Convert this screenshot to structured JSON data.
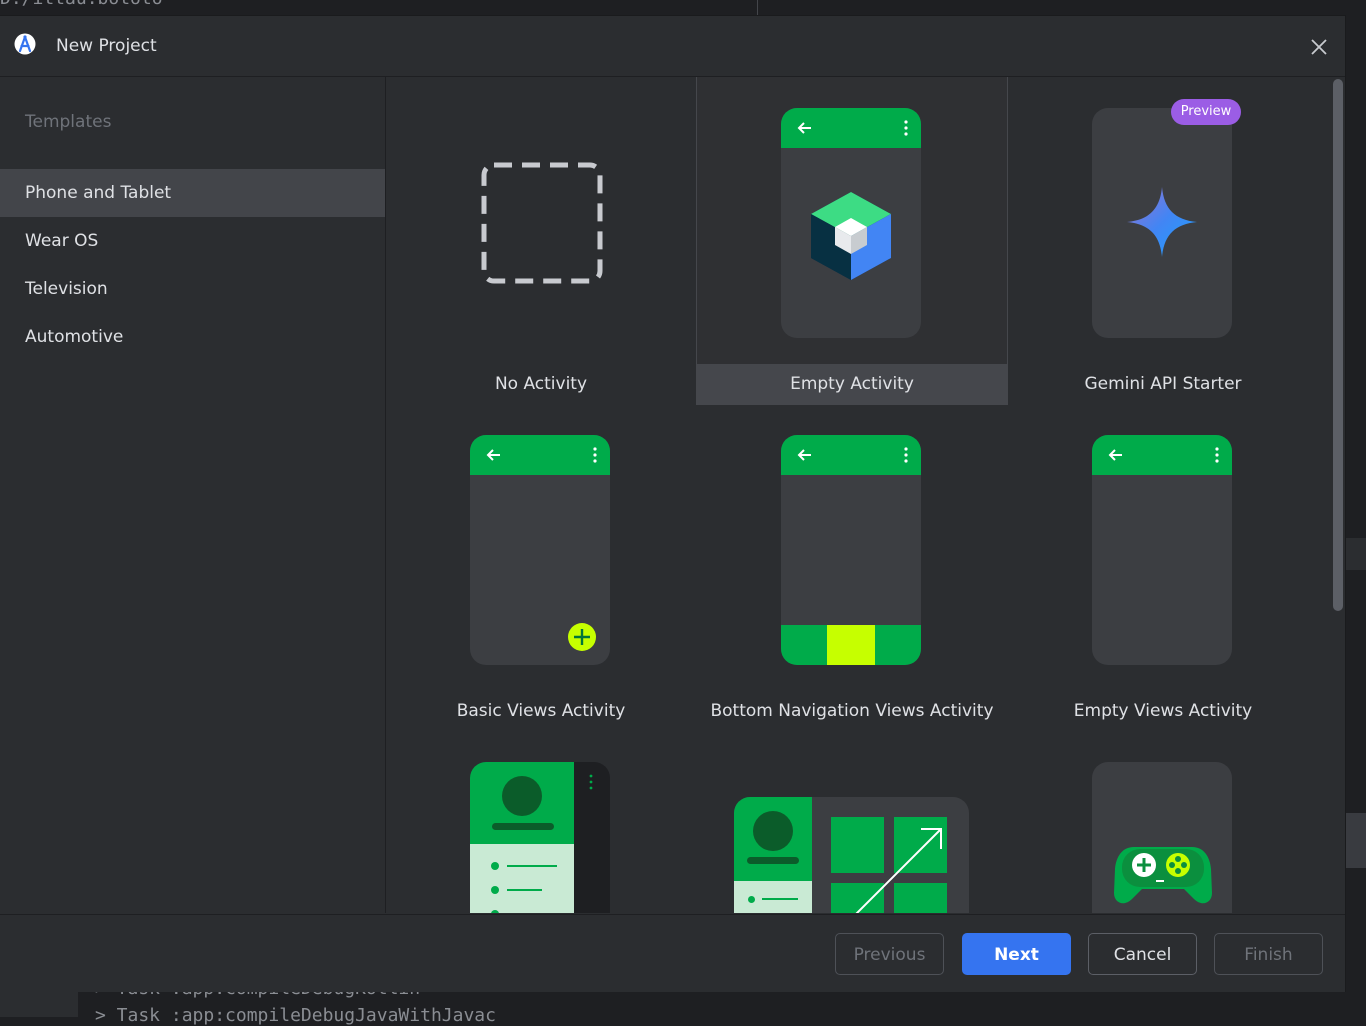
{
  "background": {
    "code_top": "D:/ittau:bototo",
    "code_line1": "> Task :app:compileDebugKotlin",
    "code_line2": "> Task :app:compileDebugJavaWithJavac"
  },
  "dialog": {
    "title": "New Project",
    "app_icon": "android-studio-icon",
    "close_icon": "close-icon"
  },
  "sidebar": {
    "header": "Templates",
    "items": [
      {
        "label": "Phone and Tablet",
        "selected": true
      },
      {
        "label": "Wear OS",
        "selected": false
      },
      {
        "label": "Television",
        "selected": false
      },
      {
        "label": "Automotive",
        "selected": false
      }
    ]
  },
  "templates": [
    {
      "label": "No Activity",
      "icon": "dashed-square-icon"
    },
    {
      "label": "Empty Activity",
      "icon": "compose-cube-icon",
      "selected": true
    },
    {
      "label": "Gemini API Starter",
      "icon": "gemini-sparkle-icon",
      "badge": "Preview"
    },
    {
      "label": "Basic Views Activity",
      "icon": "fab-plus-icon"
    },
    {
      "label": "Bottom Navigation Views Activity",
      "icon": "bottom-nav-icon"
    },
    {
      "label": "Empty Views Activity",
      "icon": "empty-phone-icon"
    },
    {
      "label": "",
      "icon": "navigation-drawer-icon"
    },
    {
      "label": "",
      "icon": "responsive-layout-icon"
    },
    {
      "label": "",
      "icon": "game-controller-icon"
    }
  ],
  "footer": {
    "previous": "Previous",
    "next": "Next",
    "cancel": "Cancel",
    "finish": "Finish"
  },
  "colors": {
    "accent": "#3574f0",
    "appbar_green": "#00ab4a",
    "lime": "#c6ff00",
    "badge_purple": "#9b5de5"
  }
}
